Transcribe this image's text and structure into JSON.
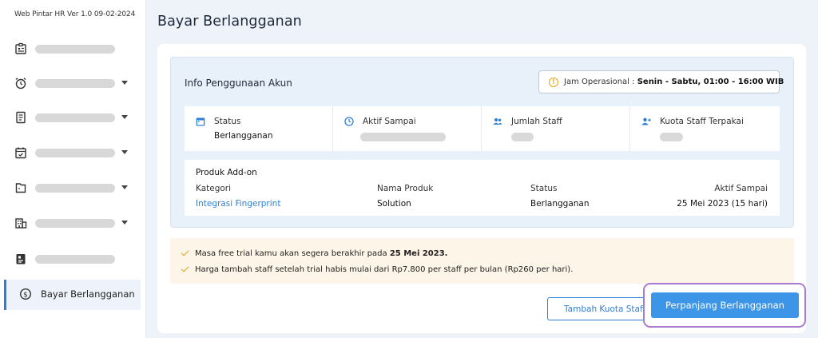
{
  "app": {
    "version": "Web Pintar HR Ver 1.0 09-02-2024"
  },
  "sidebar": {
    "items": [
      {
        "icon": "id-card-icon",
        "label": "",
        "has_chevron": false
      },
      {
        "icon": "alarm-clock-icon",
        "label": "",
        "has_chevron": true
      },
      {
        "icon": "document-icon",
        "label": "",
        "has_chevron": true
      },
      {
        "icon": "calendar-check-icon",
        "label": "",
        "has_chevron": true
      },
      {
        "icon": "folder-icon",
        "label": "",
        "has_chevron": true
      },
      {
        "icon": "building-icon",
        "label": "",
        "has_chevron": true
      },
      {
        "icon": "report-icon",
        "label": "",
        "has_chevron": false
      },
      {
        "icon": "dollar-circle-icon",
        "label": "Bayar Berlangganan",
        "has_chevron": false,
        "active": true
      }
    ]
  },
  "page": {
    "title": "Bayar Berlangganan"
  },
  "info": {
    "title": "Info Penggunaan Akun",
    "hours_label": "Jam Operasional :",
    "hours_value": "Senin - Sabtu, 01:00 - 16:00 WIB",
    "stats": [
      {
        "icon": "calendar-icon",
        "label": "Status",
        "value": "Berlangganan"
      },
      {
        "icon": "clock-icon",
        "label": "Aktif Sampai",
        "value": ""
      },
      {
        "icon": "users-icon",
        "label": "Jumlah Staff",
        "value": ""
      },
      {
        "icon": "user-plus-icon",
        "label": "Kuota Staff Terpakai",
        "value": ""
      }
    ]
  },
  "addon": {
    "title": "Produk Add-on",
    "columns": [
      "Kategori",
      "Nama Produk",
      "Status",
      "Aktif Sampai"
    ],
    "row": [
      "Integrasi Fingerprint",
      "Solution",
      "Berlangganan",
      "25 Mei 2023 (15 hari)"
    ]
  },
  "notice": {
    "line1_prefix": "Masa free trial kamu akan segera berakhir pada ",
    "line1_bold": "25 Mei 2023.",
    "line2": "Harga tambah staff setelah trial habis mulai dari Rp7.800 per staff per bulan (Rp260 per hari)."
  },
  "actions": {
    "secondary_label": "Tambah Kuota Staff",
    "primary_label": "Perpanjang Berlangganan"
  },
  "colors": {
    "accent": "#2d7fd6",
    "primary_button": "#3c95e6",
    "warning": "#e3a51a",
    "highlight": "#a87bd1"
  }
}
